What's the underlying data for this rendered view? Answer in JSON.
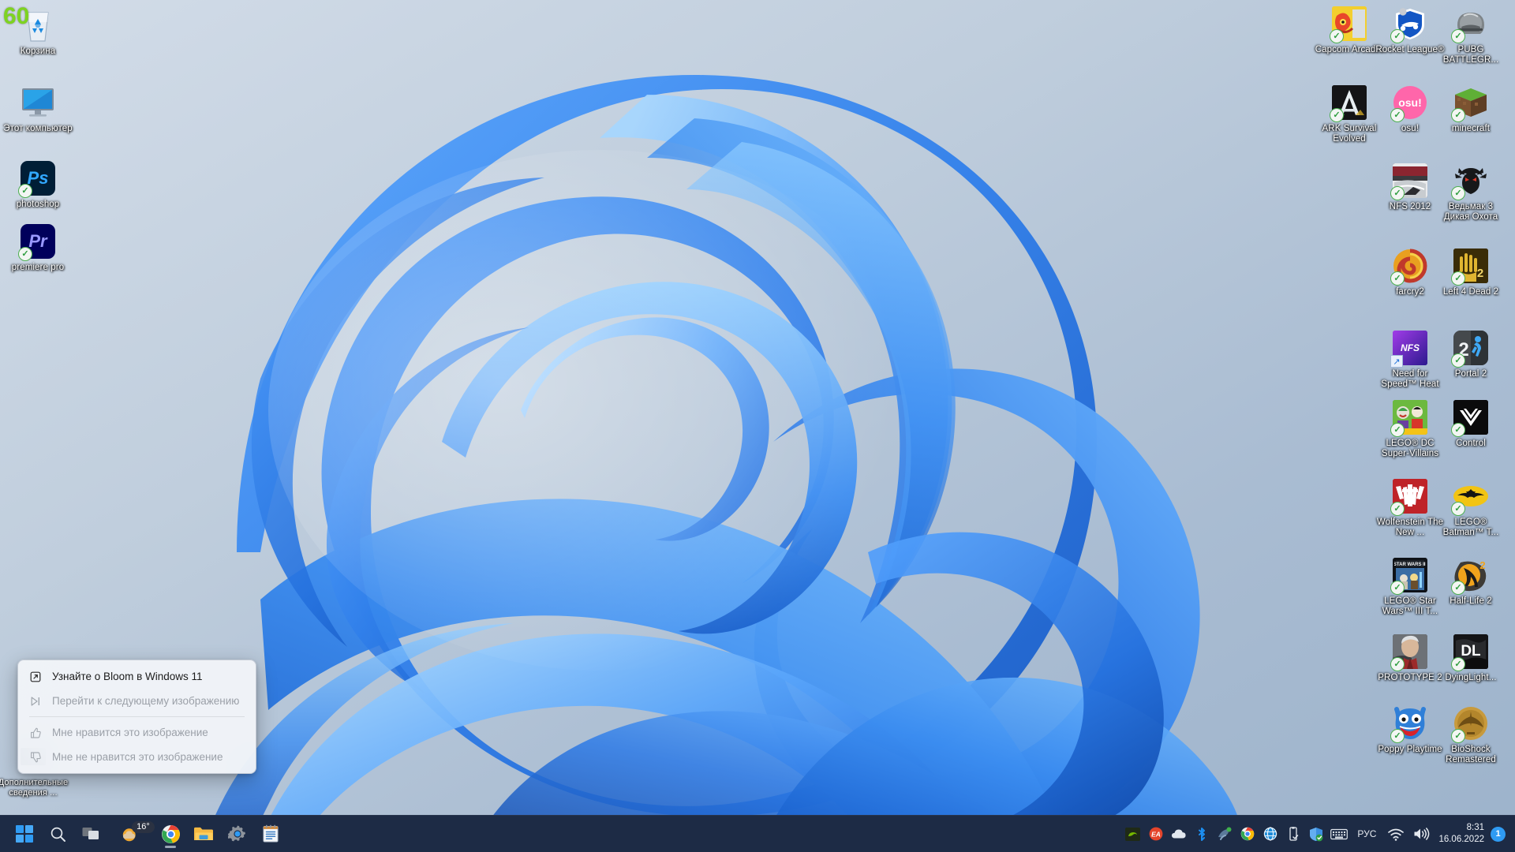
{
  "os": {
    "name": "Windows 11",
    "accent": "#2f9bf3",
    "taskbar_color": "#1d2b45"
  },
  "overlay": {
    "fps": "60"
  },
  "desktop": {
    "left_icons": [
      {
        "label": "Корзина",
        "icon": "recycle-bin-icon"
      },
      {
        "label": "Этот компьютер",
        "icon": "this-pc-icon"
      },
      {
        "label": "photoshop",
        "icon": "photoshop-icon",
        "badge": "check"
      },
      {
        "label": "premiere pro",
        "icon": "premiere-pro-icon",
        "badge": "check"
      },
      {
        "label": "Дополнительные сведения ...",
        "icon": "more-info-icon"
      }
    ],
    "game_icons": [
      {
        "label": "Capcom Arcad...",
        "icon": "capcom-arcade-icon",
        "badge": "check"
      },
      {
        "label": "Rocket League®",
        "icon": "rocket-league-icon",
        "badge": "check"
      },
      {
        "label": "PUBG BATTLEGR...",
        "icon": "pubg-icon",
        "badge": "check"
      },
      {
        "label": "ARK Survival Evolved",
        "icon": "ark-survival-icon",
        "badge": "check"
      },
      {
        "label": "osu!",
        "icon": "osu-icon",
        "badge": "check"
      },
      {
        "label": "minecraft",
        "icon": "minecraft-icon",
        "badge": "check"
      },
      {
        "label": "NFS 2012",
        "icon": "nfs-2012-icon",
        "badge": "check"
      },
      {
        "label": "Ведьмак 3 Дикая Охота",
        "icon": "witcher-3-icon",
        "badge": "check"
      },
      {
        "label": "farcry2",
        "icon": "farcry2-icon",
        "badge": "check"
      },
      {
        "label": "Left 4 Dead 2",
        "icon": "left-4-dead-2-icon",
        "badge": "check"
      },
      {
        "label": "Need for Speed™ Heat",
        "icon": "nfs-heat-icon",
        "badge": "shortcut"
      },
      {
        "label": "Portal 2",
        "icon": "portal-2-icon",
        "badge": "check"
      },
      {
        "label": "LEGO® DC Super-Villains",
        "icon": "lego-dc-icon",
        "badge": "check"
      },
      {
        "label": "Control",
        "icon": "control-icon",
        "badge": "check"
      },
      {
        "label": "Wolfenstein The New ...",
        "icon": "wolfenstein-icon",
        "badge": "check"
      },
      {
        "label": "LEGO® Batman™ T...",
        "icon": "lego-batman-icon",
        "badge": "check"
      },
      {
        "label": "LEGO® Star Wars™ III T...",
        "icon": "lego-star-wars-icon",
        "badge": "check"
      },
      {
        "label": "Half-Life 2",
        "icon": "half-life-2-icon",
        "badge": "check"
      },
      {
        "label": "PROTOTYPE 2",
        "icon": "prototype-2-icon",
        "badge": "check"
      },
      {
        "label": "DyingLight...",
        "icon": "dying-light-icon",
        "badge": "check"
      },
      {
        "label": "Poppy Playtime",
        "icon": "poppy-playtime-icon",
        "badge": "check"
      },
      {
        "label": "BioShock Remastered",
        "icon": "bioshock-icon",
        "badge": "check"
      }
    ]
  },
  "context_menu": {
    "items": [
      {
        "label": "Узнайте о Bloom в Windows 11",
        "icon": "external-link-icon",
        "enabled": true
      },
      {
        "label": "Перейти к следующему изображению",
        "icon": "next-image-icon",
        "enabled": false
      },
      {
        "label": "Мне нравится это изображение",
        "icon": "thumbs-up-icon",
        "enabled": false
      },
      {
        "label": "Мне не нравится это изображение",
        "icon": "thumbs-down-icon",
        "enabled": false
      }
    ]
  },
  "taskbar": {
    "buttons": [
      {
        "name": "start",
        "label": "Пуск",
        "icon": "windows-logo-icon"
      },
      {
        "name": "search",
        "label": "Поиск",
        "icon": "search-icon"
      },
      {
        "name": "task-view",
        "label": "Представление задач",
        "icon": "task-view-icon"
      },
      {
        "name": "weather",
        "label": "Погода",
        "icon": "weather-icon",
        "temp": "16°"
      },
      {
        "name": "chrome",
        "label": "Google Chrome",
        "icon": "chrome-icon",
        "running": true
      },
      {
        "name": "file-explorer",
        "label": "Проводник",
        "icon": "folder-icon"
      },
      {
        "name": "settings",
        "label": "Параметры",
        "icon": "gear-icon"
      },
      {
        "name": "notepad",
        "label": "Блокнот",
        "icon": "notepad-icon"
      }
    ],
    "tray_icons": [
      {
        "name": "nvidia",
        "icon": "nvidia-icon"
      },
      {
        "name": "ea-app",
        "icon": "ea-icon"
      },
      {
        "name": "onedrive",
        "icon": "cloud-icon"
      },
      {
        "name": "bluetooth",
        "icon": "bluetooth-icon"
      },
      {
        "name": "afterburner",
        "icon": "afterburner-icon"
      },
      {
        "name": "chrome-tray",
        "icon": "chrome-icon"
      },
      {
        "name": "internet-explorer",
        "icon": "globe-icon"
      },
      {
        "name": "usb-eject",
        "icon": "usb-icon"
      },
      {
        "name": "windows-security",
        "icon": "shield-icon"
      },
      {
        "name": "touch-keyboard",
        "icon": "keyboard-icon"
      }
    ],
    "language": "РУС",
    "network": {
      "icon": "wifi-icon"
    },
    "volume": {
      "icon": "speaker-icon"
    },
    "clock": {
      "time": "8:31",
      "date": "16.06.2022"
    },
    "notifications": {
      "count": "1"
    }
  }
}
